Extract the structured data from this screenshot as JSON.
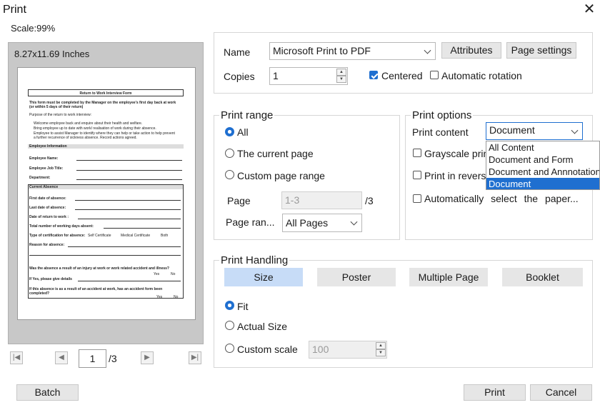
{
  "window": {
    "title": "Print",
    "scale_label": "Scale:99%"
  },
  "preview": {
    "paper_size": "8.27x11.69 Inches",
    "current_page": "1",
    "total_pages": "/3",
    "document": {
      "heading": "Return to Work Interview Form",
      "intro_bold": "This form must be completed by the Manager on the employee's first day back at work (or within 5 days of their return)",
      "purpose": "Purpose of the return to work interview:",
      "bullets": [
        "Welcome employee back and enquire about their health and welfare.",
        "Bring employee up to date with work/ realisation of work during their absence.",
        "Employee to assist Manager to identify where they can help or take action to help prevent a further recurrence of sickness absence. Record actions agreed."
      ],
      "section_employee": "Employee Information",
      "employee_fields": [
        "Employee Name:",
        "Employee Job Title:",
        "Department:"
      ],
      "section_absence": "Current Absence",
      "absence_fields": [
        "First date of absence:",
        "Last date of absence:",
        "Date of return to work :",
        "Total number of working days absent:"
      ],
      "cert_label": "Type of certification for absence:",
      "cert_options": [
        "Self Certificate",
        "Medical Certificate",
        "Both"
      ],
      "reason_label": "Reason for absence:",
      "injury_q": "Was the absence a result of an injury at work or work related accident and illness?",
      "yes": "Yes",
      "no": "No",
      "details_q": "If Yes, please give details",
      "accident_q": "If this absence is as a result of an accident at work, has an accident form been completed?"
    }
  },
  "printer": {
    "name_label": "Name",
    "name_value": "Microsoft Print to PDF",
    "attributes_button": "Attributes",
    "page_settings_button": "Page settings",
    "copies_label": "Copies",
    "copies_value": "1",
    "centered_label": "Centered",
    "centered_checked": true,
    "auto_rotation_label": "Automatic rotation",
    "auto_rotation_checked": false
  },
  "print_range": {
    "title": "Print range",
    "options": [
      "All",
      "The current page",
      "Custom page range"
    ],
    "selected": "All",
    "page_label": "Page",
    "page_placeholder": "1-3",
    "page_total": "/3",
    "page_range_label": "Page ran...",
    "page_range_value": "All Pages"
  },
  "print_options": {
    "title": "Print options",
    "content_label": "Print content",
    "content_value": "Document",
    "content_options": [
      "All Content",
      "Document and Form",
      "Document and Annnotations",
      "Document"
    ],
    "grayscale_label": "Grayscale printing",
    "reverse_label": "Print in reverse order",
    "auto_paper_label": "Automatically select the paper..."
  },
  "print_handling": {
    "title": "Print Handling",
    "tabs": [
      "Size",
      "Poster",
      "Multiple Page",
      "Booklet"
    ],
    "active_tab": "Size",
    "size_options": [
      "Fit",
      "Actual Size",
      "Custom scale"
    ],
    "selected_size": "Fit",
    "custom_scale_value": "100"
  },
  "footer": {
    "batch_button": "Batch",
    "print_button": "Print",
    "cancel_button": "Cancel"
  },
  "colors": {
    "accent": "#1f6fd0",
    "active_tab": "#c7dcf7",
    "button": "#e6e6e6"
  }
}
